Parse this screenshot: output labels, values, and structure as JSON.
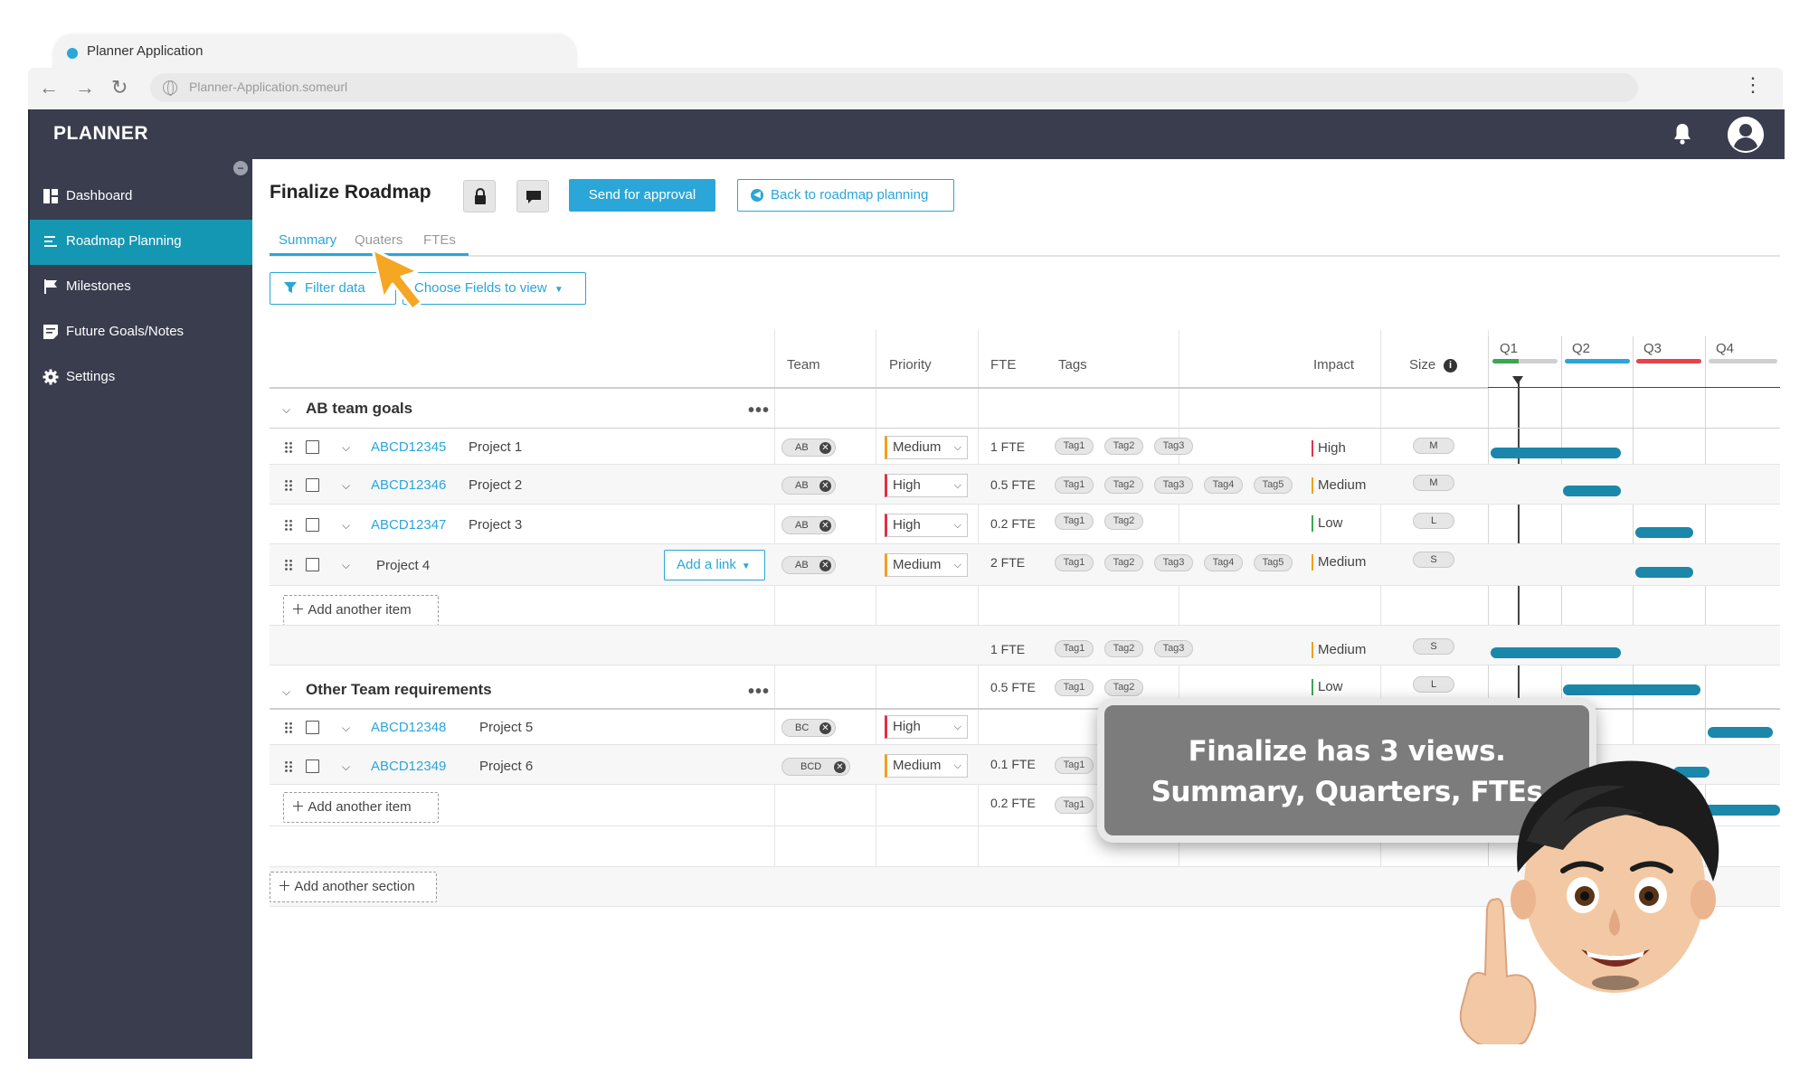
{
  "browser": {
    "tab_title": "Planner Application",
    "url": "Planner-Application.someurl"
  },
  "app": {
    "brand": "PLANNER",
    "colors": {
      "sidebar": "#393d4e",
      "active": "#1497b3",
      "accent": "#2aa6d9",
      "bar": "#1b87aa"
    }
  },
  "sidebar": {
    "items": [
      {
        "label": "Dashboard",
        "icon": "dashboard-icon"
      },
      {
        "label": "Roadmap Planning",
        "icon": "list-icon",
        "active": true
      },
      {
        "label": "Milestones",
        "icon": "flag-icon"
      },
      {
        "label": "Future Goals/Notes",
        "icon": "note-icon"
      },
      {
        "label": "Settings",
        "icon": "gear-icon"
      }
    ]
  },
  "header": {
    "title": "Finalize Roadmap",
    "send_label": "Send for approval",
    "back_label": "Back to roadmap planning"
  },
  "tabs": [
    "Summary",
    "Quaters",
    "FTEs"
  ],
  "filters": {
    "filter_label": "Filter data",
    "fields_label": "Choose Fields to view"
  },
  "columns": {
    "team": "Team",
    "priority": "Priority",
    "fte": "FTE",
    "tags": "Tags",
    "impact": "Impact",
    "size": "Size"
  },
  "quarters": [
    "Q1",
    "Q2",
    "Q3",
    "Q4"
  ],
  "sections": [
    {
      "title": "AB team goals",
      "rows": [
        {
          "id": "ABCD12345",
          "name": "Project 1",
          "team": "AB",
          "priority": "Medium",
          "fte": "1 FTE",
          "tags": [
            "Tag1",
            "Tag2",
            "Tag3"
          ],
          "impact": "High",
          "size": "M",
          "span": [
            0,
            1.8
          ]
        },
        {
          "id": "ABCD12346",
          "name": "Project 2",
          "team": "AB",
          "priority": "High",
          "fte": "0.5 FTE",
          "tags": [
            "Tag1",
            "Tag2",
            "Tag3",
            "Tag4",
            "Tag5"
          ],
          "impact": "Medium",
          "size": "M",
          "span": [
            1,
            1.8
          ]
        },
        {
          "id": "ABCD12347",
          "name": "Project 3",
          "team": "AB",
          "priority": "High",
          "fte": "0.2 FTE",
          "tags": [
            "Tag1",
            "Tag2"
          ],
          "impact": "Low",
          "size": "L",
          "span": [
            2,
            2.8
          ]
        },
        {
          "id": "",
          "name": "Project 4",
          "link_label": "Add a link",
          "team": "AB",
          "priority": "Medium",
          "fte": "2 FTE",
          "tags": [
            "Tag1",
            "Tag2",
            "Tag3",
            "Tag4",
            "Tag5"
          ],
          "impact": "Medium",
          "size": "S",
          "span": [
            2,
            2.8
          ]
        }
      ],
      "add_label": "Add another item",
      "extra_rows": [
        {
          "fte": "1 FTE",
          "tags": [
            "Tag1",
            "Tag2",
            "Tag3"
          ],
          "impact": "Medium",
          "size": "S",
          "span": [
            0,
            1.8
          ]
        },
        {
          "fte": "0.5 FTE",
          "tags": [
            "Tag1",
            "Tag2"
          ],
          "impact": "Low",
          "size": "L",
          "span": [
            1,
            2.9
          ]
        }
      ]
    },
    {
      "title": "Other Team requirements",
      "rows": [
        {
          "id": "ABCD12348",
          "name": "Project 5",
          "team": "BC",
          "priority": "High",
          "span": [
            3,
            3.9
          ]
        },
        {
          "id": "ABCD12349",
          "name": "Project 6",
          "team": "BCD",
          "priority": "Medium",
          "fte": "0.1 FTE",
          "tags": [
            "Tag1"
          ]
        }
      ],
      "add_label": "Add another item",
      "extra_rows": [
        {
          "fte": "0.2 FTE",
          "tags": [
            "Tag1"
          ]
        }
      ]
    }
  ],
  "add_section_label": "Add another section",
  "callout": {
    "line1": "Finalize has 3 views.",
    "line2": "Summary, Quarters, FTEs"
  }
}
